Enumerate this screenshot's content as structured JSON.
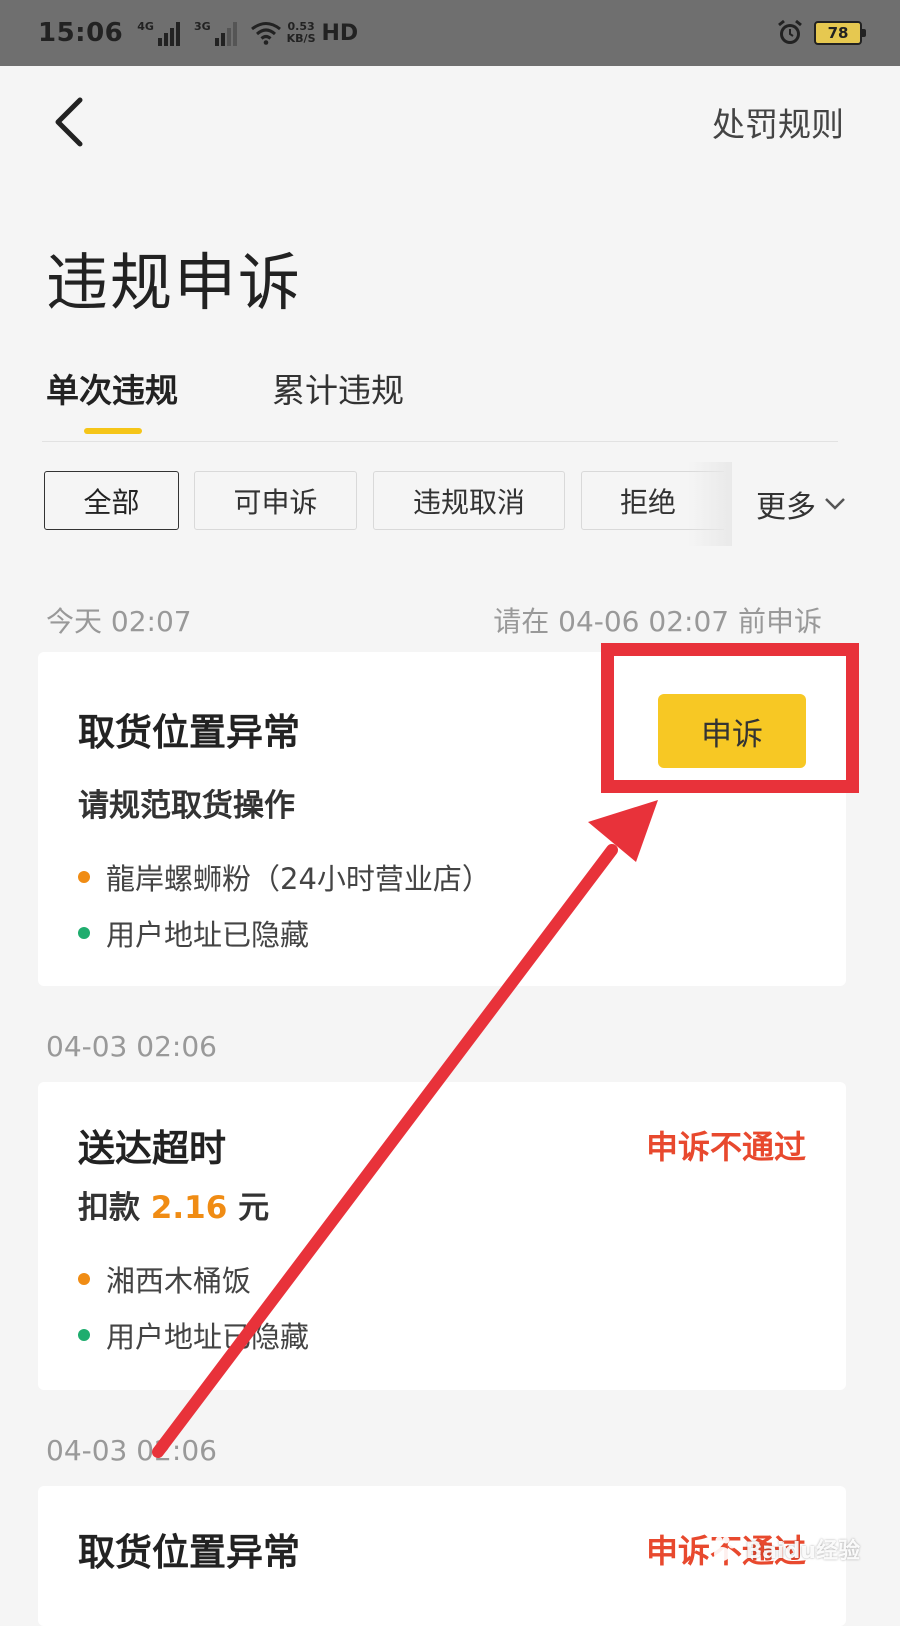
{
  "status_bar": {
    "time": "15:06",
    "network_1": "4G",
    "network_2": "3G",
    "speed_value": "0.53",
    "speed_unit": "KB/S",
    "hd": "HD",
    "battery": "78"
  },
  "header": {
    "rules_link": "处罚规则",
    "title": "违规申诉"
  },
  "tabs": [
    {
      "label": "单次违规",
      "active": true
    },
    {
      "label": "累计违规",
      "active": false
    }
  ],
  "filters": {
    "chips": [
      "全部",
      "可申诉",
      "违规取消",
      "拒绝"
    ],
    "more_label": "更多"
  },
  "records": [
    {
      "date": "今天 02:07",
      "deadline": "请在 04-06 02:07 前申诉",
      "title": "取货位置异常",
      "subtitle": "请规范取货操作",
      "shop": "龍岸螺蛳粉（24小时营业店）",
      "address": "用户地址已隐藏",
      "action_label": "申诉"
    },
    {
      "date": "04-03 02:06",
      "title": "送达超时",
      "deduction_prefix": "扣款",
      "deduction_amount": "2.16",
      "deduction_unit": "元",
      "status": "申诉不通过",
      "shop": "湘西木桶饭",
      "address": "用户地址已隐藏"
    },
    {
      "date": "04-03 02:06",
      "title": "取货位置异常",
      "status": "申诉不通过"
    }
  ],
  "colors": {
    "accent_yellow": "#f7c824",
    "reject_red": "#e8492e",
    "amount_orange": "#f08c14",
    "annotation_red": "#e8323a"
  },
  "watermark": "Baidu经验"
}
